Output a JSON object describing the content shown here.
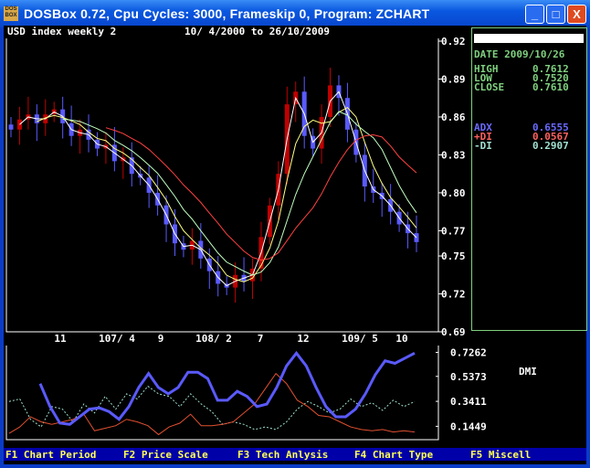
{
  "window": {
    "title": "DOSBox 0.72, Cpu Cycles:     3000, Frameskip  0, Program:   ZCHART",
    "icon_text": "DOS BOX",
    "minimize": "_",
    "maximize": "□",
    "close": "X"
  },
  "chart_header": {
    "name": "USD index weekly 2",
    "range": "10/ 4/2000 to 26/10/2009"
  },
  "info": {
    "date": "DATE 2009/10/26",
    "high_label": "HIGH",
    "high": "0.7612",
    "low_label": "LOW",
    "low": "0.7520",
    "close_label": "CLOSE",
    "close": "0.7610",
    "adx_label": "ADX",
    "adx": "0.6555",
    "pdi_label": "+DI",
    "pdi": "0.0567",
    "mdi_label": "-DI",
    "mdi": "0.2907"
  },
  "fkeys": [
    "F1 Chart Period",
    "F2 Price Scale",
    "F3 Tech Anlysis",
    "F4 Chart Type",
    "F5 Miscell"
  ],
  "colors": {
    "up": "#c00000",
    "down": "#5a5aff",
    "adx": "#5a5aff",
    "pdi": "#e05030",
    "mdi": "#a0e0d0",
    "info": "#7fd07f"
  },
  "chart_data": [
    {
      "type": "candlestick",
      "title": "USD index weekly 2",
      "ylim": [
        0.69,
        0.92
      ],
      "yticks": [
        "0.92",
        "0.89",
        "0.86",
        "0.83",
        "0.80",
        "0.77",
        "0.75",
        "0.72",
        "0.69"
      ],
      "xticks": [
        "11",
        "107/ 4",
        "9",
        "108/ 2",
        "7",
        "12",
        "109/ 5",
        "10"
      ],
      "close": [
        0.85,
        0.858,
        0.862,
        0.855,
        0.862,
        0.866,
        0.855,
        0.845,
        0.85,
        0.842,
        0.835,
        0.838,
        0.825,
        0.828,
        0.815,
        0.812,
        0.8,
        0.79,
        0.775,
        0.76,
        0.755,
        0.762,
        0.748,
        0.738,
        0.728,
        0.725,
        0.735,
        0.73,
        0.74,
        0.765,
        0.79,
        0.815,
        0.87,
        0.88,
        0.845,
        0.835,
        0.86,
        0.885,
        0.875,
        0.85,
        0.83,
        0.805,
        0.8,
        0.795,
        0.785,
        0.775,
        0.768,
        0.761
      ]
    },
    {
      "type": "line",
      "title": "DMI",
      "label": "DMI",
      "ylim": [
        0.04,
        0.78
      ],
      "yticks": [
        "0.7262",
        "0.5373",
        "0.3411",
        "0.1449"
      ],
      "series": [
        {
          "name": "ADX",
          "values": [
            0.48,
            0.3,
            0.17,
            0.16,
            0.22,
            0.28,
            0.29,
            0.26,
            0.2,
            0.3,
            0.45,
            0.56,
            0.45,
            0.4,
            0.45,
            0.57,
            0.57,
            0.52,
            0.35,
            0.35,
            0.42,
            0.38,
            0.3,
            0.32,
            0.45,
            0.62,
            0.72,
            0.62,
            0.45,
            0.3,
            0.22,
            0.22,
            0.28,
            0.4,
            0.55,
            0.66,
            0.64,
            0.68,
            0.72
          ]
        },
        {
          "name": "+DI",
          "values": [
            0.09,
            0.14,
            0.22,
            0.18,
            0.16,
            0.18,
            0.2,
            0.24,
            0.11,
            0.13,
            0.15,
            0.2,
            0.18,
            0.15,
            0.08,
            0.14,
            0.17,
            0.24,
            0.15,
            0.15,
            0.16,
            0.18,
            0.25,
            0.32,
            0.44,
            0.56,
            0.48,
            0.35,
            0.3,
            0.23,
            0.22,
            0.18,
            0.14,
            0.12,
            0.11,
            0.12,
            0.1,
            0.11,
            0.1
          ]
        },
        {
          "name": "-DI",
          "values": [
            0.34,
            0.36,
            0.2,
            0.14,
            0.3,
            0.28,
            0.18,
            0.32,
            0.25,
            0.38,
            0.28,
            0.4,
            0.36,
            0.46,
            0.4,
            0.38,
            0.3,
            0.4,
            0.32,
            0.26,
            0.16,
            0.18,
            0.16,
            0.12,
            0.14,
            0.12,
            0.18,
            0.28,
            0.34,
            0.3,
            0.25,
            0.28,
            0.36,
            0.3,
            0.33,
            0.27,
            0.35,
            0.3,
            0.34
          ]
        }
      ]
    }
  ]
}
